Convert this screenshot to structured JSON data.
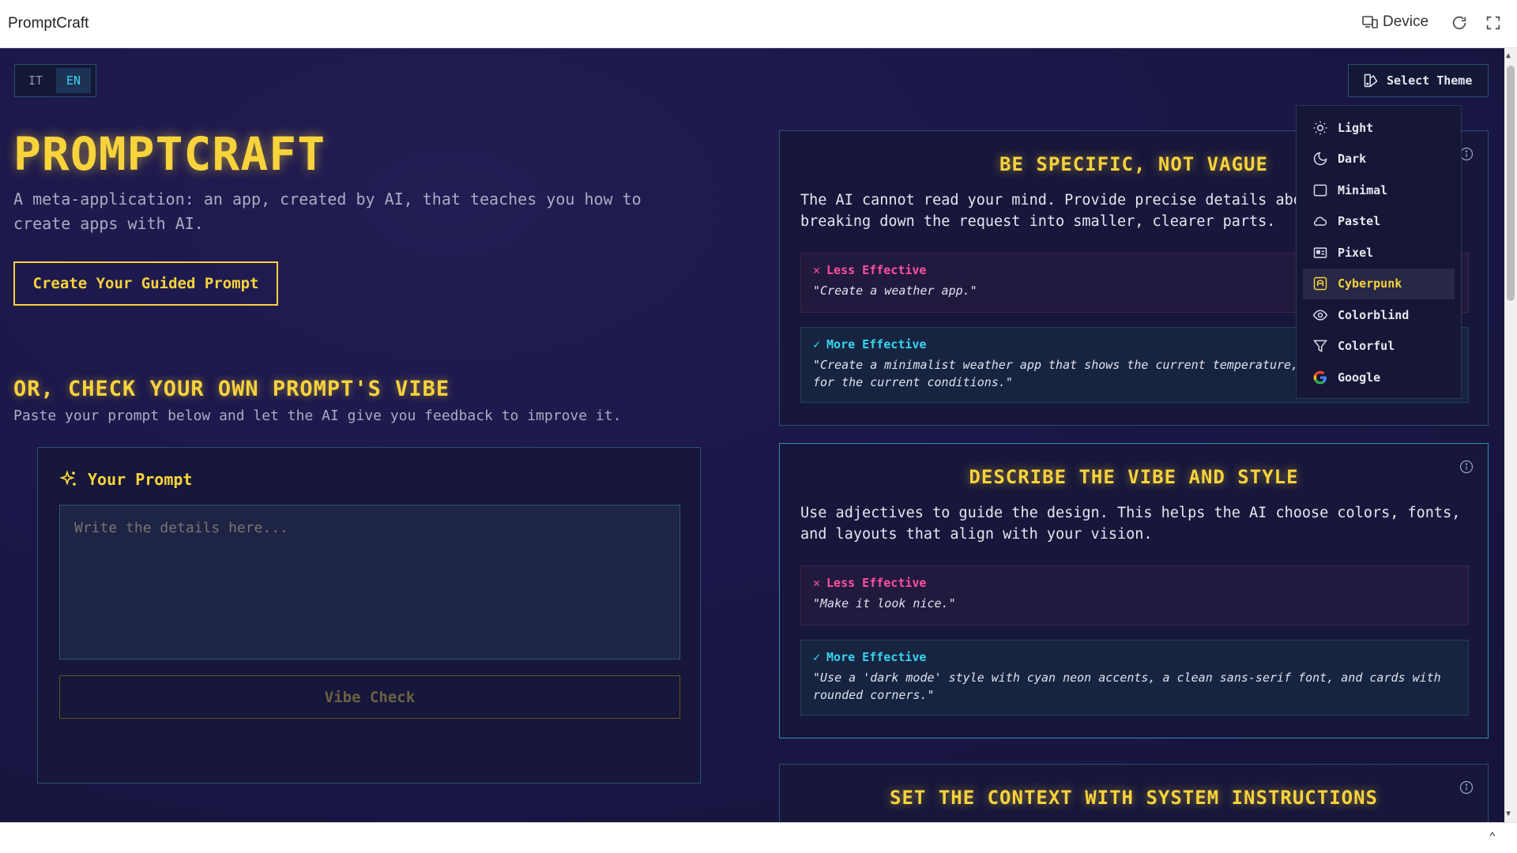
{
  "window": {
    "title": "PromptCraft",
    "device_label": "Device"
  },
  "lang": {
    "options": [
      "IT",
      "EN"
    ],
    "active": "EN"
  },
  "theme": {
    "button_label": "Select Theme",
    "items": [
      {
        "label": "Light",
        "icon": "sun-icon"
      },
      {
        "label": "Dark",
        "icon": "moon-icon"
      },
      {
        "label": "Minimal",
        "icon": "square-icon"
      },
      {
        "label": "Pastel",
        "icon": "cloud-icon"
      },
      {
        "label": "Pixel",
        "icon": "pixel-icon"
      },
      {
        "label": "Cyberpunk",
        "icon": "cyberpunk-icon"
      },
      {
        "label": "Colorblind",
        "icon": "eye-icon"
      },
      {
        "label": "Colorful",
        "icon": "funnel-icon"
      },
      {
        "label": "Google",
        "icon": "google-icon"
      }
    ],
    "selected": "Cyberpunk"
  },
  "hero": {
    "title": "PROMPTCRAFT",
    "subtitle": "A meta-application: an app, created by AI, that teaches you how to create apps with AI.",
    "cta": "Create Your Guided Prompt"
  },
  "check": {
    "title": "OR, CHECK YOUR OWN PROMPT'S VIBE",
    "subtitle": "Paste your prompt below and let the AI give you feedback to improve it.",
    "prompt_label": "Your Prompt",
    "placeholder": "Write the details here...",
    "button": "Vibe Check"
  },
  "tips": [
    {
      "title": "BE SPECIFIC, NOT VAGUE",
      "body": "The AI cannot read your mind. Provide precise details about what you want, breaking down the request into smaller, clearer parts.",
      "less_label": "Less Effective",
      "less_text": "\"Create a weather app.\"",
      "more_label": "More Effective",
      "more_text": "\"Create a minimalist weather app that shows the current temperature, humidity, and an icon for the current conditions.\""
    },
    {
      "title": "DESCRIBE THE VIBE AND STYLE",
      "body": "Use adjectives to guide the design. This helps the AI choose colors, fonts, and layouts that align with your vision.",
      "less_label": "Less Effective",
      "less_text": "\"Make it look nice.\"",
      "more_label": "More Effective",
      "more_text": "\"Use a 'dark mode' style with cyan neon accents, a clean sans-serif font, and cards with rounded corners.\""
    },
    {
      "title": "SET THE CONTEXT WITH SYSTEM INSTRUCTIONS"
    }
  ],
  "colors": {
    "accent": "#f8d33b",
    "cyan": "#38d5ef",
    "pink": "#ff4fa0",
    "background": "#1b1748"
  }
}
